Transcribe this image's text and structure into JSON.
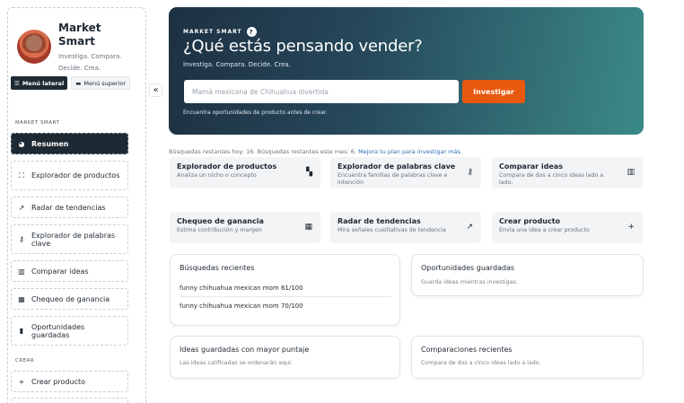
{
  "sidebar": {
    "brand_name": "Market Smart",
    "brand_tagline": "Investiga. Compara. Decide. Crea.",
    "toggle_side": "Menú lateral",
    "toggle_top": "Menú superior",
    "collapse": "«",
    "section_main": "MARKET SMART",
    "section_create": "CREAR",
    "items": [
      {
        "label": "Resumen",
        "icon": "chart-pie-icon",
        "glyph": "◕"
      },
      {
        "label": "Explorador de productos",
        "icon": "binoculars-icon",
        "glyph": "⛶"
      },
      {
        "label": "Radar de tendencias",
        "icon": "trend-icon",
        "glyph": "↗"
      },
      {
        "label": "Explorador de palabras clave",
        "icon": "key-icon",
        "glyph": "⚷"
      },
      {
        "label": "Comparar ideas",
        "icon": "columns-icon",
        "glyph": "▥"
      },
      {
        "label": "Chequeo de ganancia",
        "icon": "calculator-icon",
        "glyph": "▦"
      },
      {
        "label": "Oportunidades guardadas",
        "icon": "bookmark-icon",
        "glyph": "▮"
      }
    ],
    "create_items": [
      {
        "label": "Crear producto",
        "icon": "plus-icon",
        "glyph": "+"
      }
    ]
  },
  "hero": {
    "kicker": "MARKET SMART",
    "help": "?",
    "title": "¿Qué estás pensando vender?",
    "subtitle": "Investiga. Compara. Decide. Crea.",
    "input_placeholder": "Mamá mexicana de Chihuahua divertida",
    "button": "Investigar",
    "footnote": "Encuentra oportunidades de producto antes de crear."
  },
  "quota": {
    "text": "Búsquedas restantes hoy: 16. Búsquedas restantes este mes: 6.",
    "link": "Mejora tu plan para investigar más."
  },
  "tools": [
    {
      "title": "Explorador de productos",
      "desc": "Analiza un nicho o concepto",
      "icon": "binoculars-icon",
      "glyph": "▚"
    },
    {
      "title": "Explorador de palabras clave",
      "desc": "Encuentra familias de palabras clave e intención",
      "icon": "key-icon",
      "glyph": "⚷"
    },
    {
      "title": "Comparar ideas",
      "desc": "Compara de dos a cinco ideas lado a lado.",
      "icon": "columns-icon",
      "glyph": "▥"
    },
    {
      "title": "Chequeo de ganancia",
      "desc": "Estima contribución y margen",
      "icon": "calculator-icon",
      "glyph": "▦"
    },
    {
      "title": "Radar de tendencias",
      "desc": "Mira señales cualitativas de tendencia",
      "icon": "trend-icon",
      "glyph": "↗"
    },
    {
      "title": "Crear producto",
      "desc": "Envía una idea a crear producto",
      "icon": "plus-icon",
      "glyph": "+"
    }
  ],
  "panels": {
    "recent": {
      "title": "Búsquedas recientes",
      "rows": [
        "funny chihuahua mexican mom 61/100",
        "funny chihuahua mexican mom 70/100"
      ]
    },
    "saved": {
      "title": "Oportunidades guardadas",
      "empty": "Guarda ideas mientras investigas."
    },
    "top_ideas": {
      "title": "Ideas guardadas con mayor puntaje",
      "empty": "Las ideas calificadas se ordenarán aquí."
    },
    "comparisons": {
      "title": "Comparaciones recientes",
      "empty": "Compara de dos a cinco ideas lado a lado."
    }
  }
}
